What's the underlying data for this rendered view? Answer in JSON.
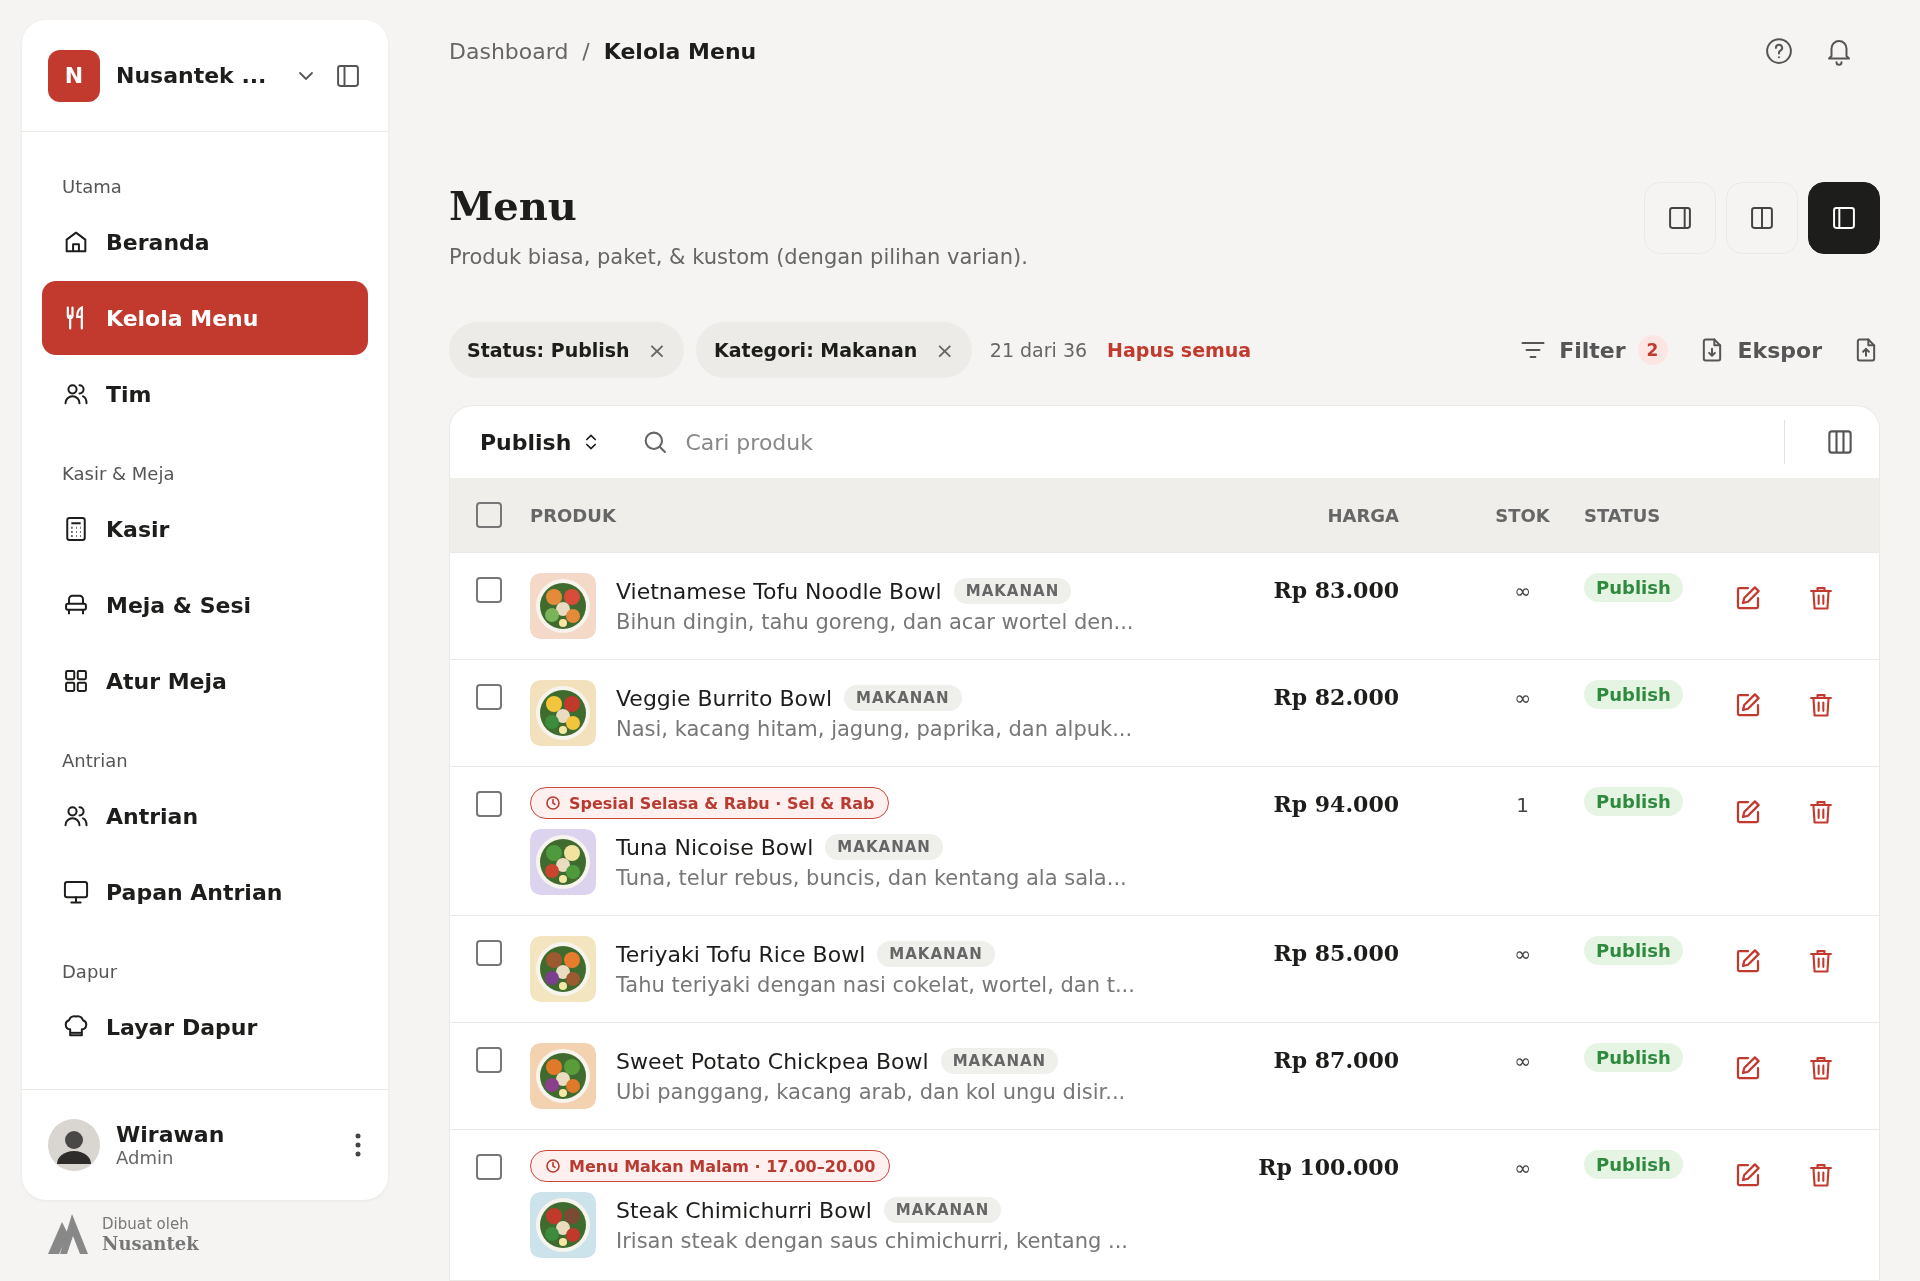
{
  "sidebar": {
    "workspace": {
      "initial": "N",
      "name": "Nusantek ..."
    },
    "sections": [
      {
        "label": "Utama",
        "items": [
          {
            "label": "Beranda",
            "selected": false
          },
          {
            "label": "Kelola Menu",
            "selected": true
          },
          {
            "label": "Tim",
            "selected": false
          }
        ]
      },
      {
        "label": "Kasir & Meja",
        "items": [
          {
            "label": "Kasir",
            "selected": false
          },
          {
            "label": "Meja & Sesi",
            "selected": false
          },
          {
            "label": "Atur Meja",
            "selected": false
          }
        ]
      },
      {
        "label": "Antrian",
        "items": [
          {
            "label": "Antrian",
            "selected": false
          },
          {
            "label": "Papan Antrian",
            "selected": false
          }
        ]
      },
      {
        "label": "Dapur",
        "items": [
          {
            "label": "Layar Dapur",
            "selected": false
          }
        ]
      }
    ],
    "user": {
      "name": "Wirawan",
      "role": "Admin"
    },
    "credit": {
      "caption": "Dibuat oleh",
      "brand": "Nusantek"
    }
  },
  "breadcrumb": {
    "items": [
      "Dashboard",
      "Kelola Menu"
    ],
    "separator": "/"
  },
  "page": {
    "title": "Menu",
    "subtitle": "Produk biasa, paket, & kustom (dengan pilihan varian)."
  },
  "view_toggle": [
    {
      "selected": false
    },
    {
      "selected": false
    },
    {
      "selected": true
    }
  ],
  "filters": {
    "chips": [
      {
        "label": "Status: Publish",
        "remove": "×"
      },
      {
        "label": "Kategori: Makanan",
        "remove": "×"
      }
    ],
    "count": "21 dari 36",
    "clear": "Hapus semua"
  },
  "actions": {
    "filter": {
      "label": "Filter",
      "badge": "2"
    },
    "export": {
      "label": "Ekspor"
    }
  },
  "toolbar": {
    "status_select": "Publish",
    "search": {
      "placeholder": "Cari produk"
    }
  },
  "table": {
    "select_all": {
      "checked": false
    },
    "columns": [
      "PRODUK",
      "HARGA",
      "STOK",
      "STATUS"
    ],
    "rows": [
      {
        "checked": false,
        "name": "Vietnamese Tofu Noodle Bowl",
        "category": "MAKANAN",
        "description": "Bihun dingin, tahu goreng, dan acar wortel den...",
        "price": "Rp 83.000",
        "stock": "∞",
        "status": "Publish"
      },
      {
        "checked": false,
        "name": "Veggie Burrito Bowl",
        "category": "MAKANAN",
        "description": "Nasi, kacang hitam, jagung, paprika, dan alpuk...",
        "price": "Rp 82.000",
        "stock": "∞",
        "status": "Publish"
      },
      {
        "checked": false,
        "schedule": "Spesial Selasa & Rabu · Sel & Rab",
        "name": "Tuna Nicoise Bowl",
        "category": "MAKANAN",
        "description": "Tuna, telur rebus, buncis, dan kentang ala sala...",
        "price": "Rp 94.000",
        "stock": "1",
        "status": "Publish"
      },
      {
        "checked": false,
        "name": "Teriyaki Tofu Rice Bowl",
        "category": "MAKANAN",
        "description": "Tahu teriyaki dengan nasi cokelat, wortel, dan t...",
        "price": "Rp 85.000",
        "stock": "∞",
        "status": "Publish"
      },
      {
        "checked": false,
        "name": "Sweet Potato Chickpea Bowl",
        "category": "MAKANAN",
        "description": "Ubi panggang, kacang arab, dan kol ungu disir...",
        "price": "Rp 87.000",
        "stock": "∞",
        "status": "Publish"
      },
      {
        "checked": false,
        "schedule": "Menu Makan Malam · 17.00–20.00",
        "name": "Steak Chimichurri Bowl",
        "category": "MAKANAN",
        "description": "Irisan steak dengan saus chimichurri, kentang ...",
        "price": "Rp 100.000",
        "stock": "∞",
        "status": "Publish"
      }
    ]
  }
}
